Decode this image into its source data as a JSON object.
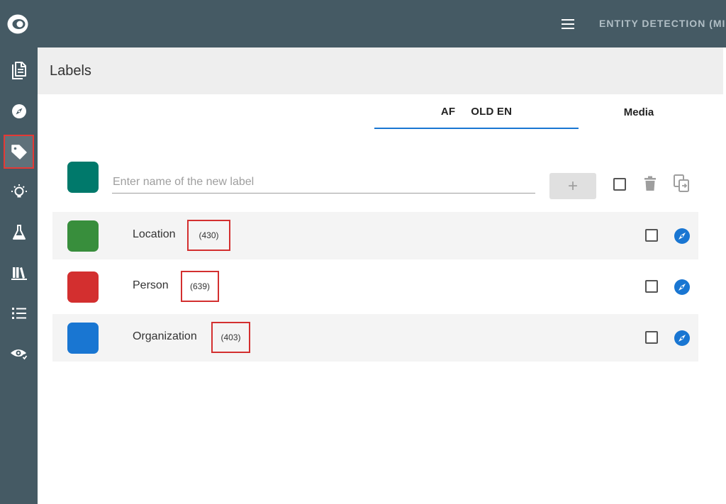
{
  "header": {
    "app_title": "ENTITY DETECTION (MI",
    "menu_icon": "hamburger-menu-icon",
    "logo_icon": "eye-logo-icon"
  },
  "sidebar": {
    "items": [
      {
        "icon": "documents-icon",
        "active": false
      },
      {
        "icon": "compass-icon",
        "active": false
      },
      {
        "icon": "tag-icon",
        "active": true
      },
      {
        "icon": "lightbulb-icon",
        "active": false
      },
      {
        "icon": "flask-icon",
        "active": false
      },
      {
        "icon": "library-icon",
        "active": false
      },
      {
        "icon": "list-icon",
        "active": false
      },
      {
        "icon": "eye-check-icon",
        "active": false
      }
    ]
  },
  "page": {
    "title": "Labels"
  },
  "tabs": [
    {
      "label_a": "AF",
      "label_b": "OLD EN",
      "active": true
    },
    {
      "label": "Media",
      "active": false
    }
  ],
  "new_label": {
    "swatch_color": "#00796b",
    "placeholder": "Enter name of the new label",
    "value": "",
    "add_label": "+"
  },
  "labels": [
    {
      "name": "Location",
      "count": "(430)",
      "color": "#388e3c"
    },
    {
      "name": "Person",
      "count": "(639)",
      "color": "#d32f2f"
    },
    {
      "name": "Organization",
      "count": "(403)",
      "color": "#1976d2"
    }
  ],
  "colors": {
    "topbar": "#455a64",
    "accent": "#1976d2",
    "highlight": "#d32f2f"
  }
}
